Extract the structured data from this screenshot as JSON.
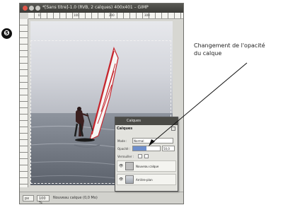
{
  "step_badge": "❺",
  "window": {
    "title": "*[Sans titre]-1.0 (RVB, 2 calques) 400x401 – GIMP",
    "title_bar_color": "#3f3f3b"
  },
  "ruler": {
    "labels": [
      "0",
      "100",
      "200",
      "300"
    ]
  },
  "canvas": {
    "layer_name_shown": "Arrière-plan"
  },
  "statusbar": {
    "unit": "px",
    "zoom": "100 %",
    "text": "Nouveau calque (0,0 Mo)"
  },
  "layers_panel": {
    "title": "Calques",
    "tab_label": "Calques",
    "mode_label": "Mode :",
    "mode_value": "Normal",
    "opacity_label": "Opacité :",
    "opacity_value": "50,0",
    "opacity_percent": 50,
    "lock_label": "Verrouiller :",
    "layers": [
      {
        "name": "Nouveau calque",
        "icon": "eye-icon"
      },
      {
        "name": "Arrière-plan",
        "icon": "eye-icon"
      }
    ]
  },
  "callout": {
    "text_line1": "Changement de l'opacité",
    "text_line2": "du calque"
  }
}
